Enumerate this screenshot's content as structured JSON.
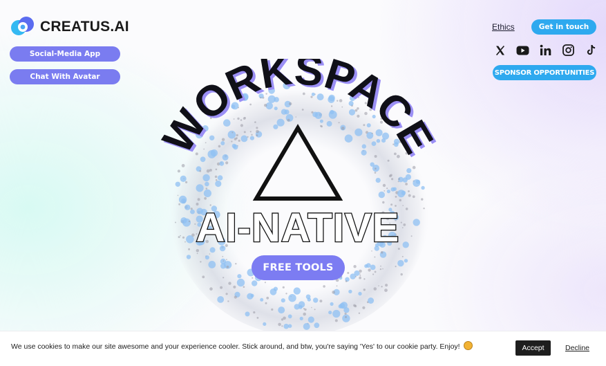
{
  "brand": {
    "name": "CREATUS.AI",
    "logo_icon": "creatus-logo-icon",
    "colors": {
      "primary": "#7a7cf0",
      "accent": "#2ea9ef"
    }
  },
  "nav": {
    "social_media_app": "Social-Media App",
    "chat_with_avatar": "Chat With Avatar",
    "ethics": "Ethics",
    "get_in_touch": "Get in touch",
    "sponsor": "SPONSOR OPPORTUNITIES"
  },
  "socials": [
    "x-icon",
    "youtube-icon",
    "linkedin-icon",
    "instagram-icon",
    "tiktok-icon"
  ],
  "hero": {
    "arc_text": "WORKSPACE",
    "main_text": "AI-NATIVE",
    "symbol": "triangle-icon",
    "cta": "FREE TOOLS"
  },
  "cookie": {
    "message": "We use cookies to make our site awesome and your experience cooler. Stick around, and btw, you're saying 'Yes' to our cookie party. Enjoy!",
    "emoji": "cookie-icon",
    "accept": "Accept",
    "decline": "Decline"
  }
}
